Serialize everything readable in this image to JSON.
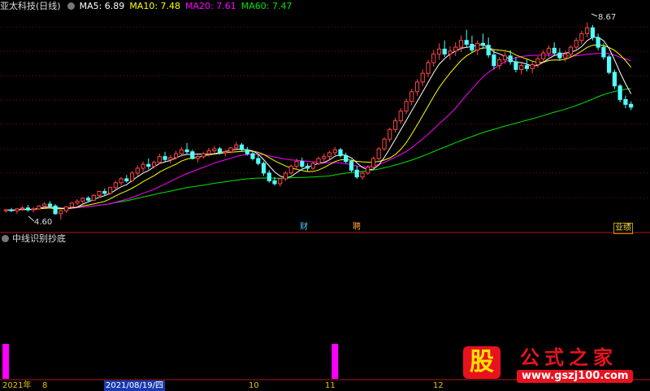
{
  "header": {
    "title": "亚太科技(日线)",
    "ma5": "MA5: 6.89",
    "ma10": "MA10: 7.48",
    "ma20": "MA20: 7.61",
    "ma60": "MA60: 7.47"
  },
  "sub_panel": {
    "title": "中线识别抄底"
  },
  "price_labels": {
    "high": "8.67",
    "low": "4.60"
  },
  "events": {
    "e1": "财",
    "e2": "聘",
    "e3": "业绩"
  },
  "x_axis": {
    "year": "2021年",
    "m8": "8",
    "cursor_date": "2021/08/19/四",
    "m10": "10",
    "m11": "11",
    "m12": "12"
  },
  "watermark": {
    "badge": "股",
    "title": "公式之家",
    "url": "www.gszj100.com"
  },
  "colors": {
    "up": "#ff4545",
    "down": "#54ffff",
    "ma5": "#ffffff",
    "ma10": "#ffff00",
    "ma20": "#ff00ff",
    "ma60": "#00e400",
    "signal": "#ff00ff"
  },
  "chart_data": {
    "type": "candlestick",
    "title": "亚太科技(日线)",
    "x_range": [
      "2021-07",
      "2021-12"
    ],
    "y_range": [
      4.5,
      8.9
    ],
    "candles_ohlc": [
      [
        4.78,
        4.82,
        4.74,
        4.8
      ],
      [
        4.8,
        4.84,
        4.76,
        4.78
      ],
      [
        4.78,
        4.84,
        4.72,
        4.82
      ],
      [
        4.82,
        4.88,
        4.78,
        4.84
      ],
      [
        4.84,
        4.9,
        4.76,
        4.8
      ],
      [
        4.8,
        4.86,
        4.74,
        4.82
      ],
      [
        4.82,
        4.9,
        4.8,
        4.88
      ],
      [
        4.88,
        4.96,
        4.84,
        4.92
      ],
      [
        4.92,
        4.98,
        4.86,
        4.88
      ],
      [
        4.88,
        4.92,
        4.7,
        4.72
      ],
      [
        4.72,
        4.8,
        4.6,
        4.78
      ],
      [
        4.78,
        4.88,
        4.74,
        4.86
      ],
      [
        4.86,
        4.96,
        4.82,
        4.94
      ],
      [
        4.94,
        5.02,
        4.9,
        4.98
      ],
      [
        4.98,
        5.06,
        4.94,
        5.04
      ],
      [
        5.04,
        5.08,
        4.96,
        5.0
      ],
      [
        5.0,
        5.12,
        4.98,
        5.1
      ],
      [
        5.1,
        5.2,
        5.06,
        5.18
      ],
      [
        5.18,
        5.24,
        5.1,
        5.14
      ],
      [
        5.14,
        5.28,
        5.12,
        5.26
      ],
      [
        5.26,
        5.4,
        5.22,
        5.36
      ],
      [
        5.36,
        5.48,
        5.3,
        5.44
      ],
      [
        5.44,
        5.52,
        5.36,
        5.4
      ],
      [
        5.4,
        5.6,
        5.38,
        5.56
      ],
      [
        5.56,
        5.72,
        5.5,
        5.66
      ],
      [
        5.66,
        5.8,
        5.58,
        5.74
      ],
      [
        5.74,
        5.86,
        5.64,
        5.7
      ],
      [
        5.7,
        5.82,
        5.66,
        5.78
      ],
      [
        5.78,
        5.96,
        5.74,
        5.9
      ],
      [
        5.9,
        6.0,
        5.78,
        5.84
      ],
      [
        5.84,
        5.94,
        5.76,
        5.88
      ],
      [
        5.88,
        6.02,
        5.84,
        5.96
      ],
      [
        5.96,
        6.1,
        5.9,
        6.04
      ],
      [
        6.04,
        6.18,
        5.94,
        6.0
      ],
      [
        6.0,
        6.04,
        5.84,
        5.86
      ],
      [
        5.86,
        5.94,
        5.78,
        5.9
      ],
      [
        5.9,
        6.0,
        5.86,
        5.96
      ],
      [
        5.96,
        6.08,
        5.9,
        6.02
      ],
      [
        6.02,
        6.12,
        5.96,
        6.06
      ],
      [
        6.06,
        6.1,
        5.94,
        5.98
      ],
      [
        5.98,
        6.04,
        5.9,
        6.0
      ],
      [
        6.0,
        6.1,
        5.96,
        6.08
      ],
      [
        6.08,
        6.2,
        6.02,
        6.14
      ],
      [
        6.14,
        6.18,
        6.0,
        6.04
      ],
      [
        6.04,
        6.1,
        5.92,
        5.96
      ],
      [
        5.96,
        6.0,
        5.82,
        5.86
      ],
      [
        5.86,
        5.94,
        5.72,
        5.76
      ],
      [
        5.76,
        5.8,
        5.5,
        5.56
      ],
      [
        5.56,
        5.62,
        5.36,
        5.4
      ],
      [
        5.4,
        5.48,
        5.3,
        5.34
      ],
      [
        5.34,
        5.46,
        5.28,
        5.44
      ],
      [
        5.44,
        5.6,
        5.4,
        5.56
      ],
      [
        5.56,
        5.74,
        5.52,
        5.7
      ],
      [
        5.7,
        5.86,
        5.64,
        5.8
      ],
      [
        5.8,
        5.88,
        5.66,
        5.7
      ],
      [
        5.7,
        5.76,
        5.6,
        5.66
      ],
      [
        5.66,
        5.8,
        5.62,
        5.76
      ],
      [
        5.76,
        5.9,
        5.72,
        5.86
      ],
      [
        5.86,
        5.96,
        5.8,
        5.9
      ],
      [
        5.9,
        6.02,
        5.84,
        5.98
      ],
      [
        5.98,
        6.1,
        5.92,
        6.04
      ],
      [
        6.04,
        6.08,
        5.88,
        5.92
      ],
      [
        5.92,
        5.98,
        5.76,
        5.8
      ],
      [
        5.8,
        5.84,
        5.58,
        5.62
      ],
      [
        5.62,
        5.7,
        5.44,
        5.48
      ],
      [
        5.48,
        5.6,
        5.42,
        5.56
      ],
      [
        5.56,
        5.72,
        5.52,
        5.68
      ],
      [
        5.68,
        5.9,
        5.64,
        5.86
      ],
      [
        5.86,
        6.1,
        5.82,
        6.06
      ],
      [
        6.06,
        6.3,
        6.02,
        6.26
      ],
      [
        6.26,
        6.5,
        6.2,
        6.46
      ],
      [
        6.46,
        6.7,
        6.4,
        6.64
      ],
      [
        6.64,
        6.9,
        6.58,
        6.84
      ],
      [
        6.84,
        7.1,
        6.78,
        7.04
      ],
      [
        7.04,
        7.3,
        6.96,
        7.24
      ],
      [
        7.24,
        7.5,
        7.16,
        7.44
      ],
      [
        7.44,
        7.7,
        7.36,
        7.62
      ],
      [
        7.62,
        7.9,
        7.54,
        7.84
      ],
      [
        7.84,
        8.1,
        7.76,
        8.02
      ],
      [
        8.02,
        8.24,
        7.9,
        8.12
      ],
      [
        8.12,
        8.3,
        7.96,
        8.02
      ],
      [
        8.02,
        8.18,
        7.9,
        8.08
      ],
      [
        8.08,
        8.26,
        7.98,
        8.16
      ],
      [
        8.16,
        8.4,
        8.06,
        8.3
      ],
      [
        8.3,
        8.52,
        8.16,
        8.22
      ],
      [
        8.22,
        8.4,
        8.04,
        8.1
      ],
      [
        8.1,
        8.3,
        8.0,
        8.24
      ],
      [
        8.24,
        8.44,
        8.12,
        8.2
      ],
      [
        8.2,
        8.36,
        7.94,
        8.0
      ],
      [
        8.0,
        8.1,
        7.7,
        7.78
      ],
      [
        7.78,
        7.96,
        7.7,
        7.9
      ],
      [
        7.9,
        8.06,
        7.82,
        7.98
      ],
      [
        7.98,
        8.1,
        7.8,
        7.86
      ],
      [
        7.86,
        7.96,
        7.64,
        7.7
      ],
      [
        7.7,
        7.84,
        7.6,
        7.78
      ],
      [
        7.78,
        7.9,
        7.66,
        7.72
      ],
      [
        7.72,
        7.86,
        7.62,
        7.8
      ],
      [
        7.8,
        7.98,
        7.74,
        7.92
      ],
      [
        7.92,
        8.1,
        7.86,
        8.04
      ],
      [
        8.04,
        8.2,
        7.96,
        8.14
      ],
      [
        8.14,
        8.26,
        7.98,
        8.04
      ],
      [
        8.04,
        8.14,
        7.88,
        7.94
      ],
      [
        7.94,
        8.08,
        7.86,
        8.02
      ],
      [
        8.02,
        8.2,
        7.96,
        8.16
      ],
      [
        8.16,
        8.36,
        8.1,
        8.3
      ],
      [
        8.3,
        8.5,
        8.22,
        8.44
      ],
      [
        8.44,
        8.67,
        8.36,
        8.56
      ],
      [
        8.56,
        8.62,
        8.3,
        8.36
      ],
      [
        8.36,
        8.44,
        8.1,
        8.16
      ],
      [
        8.16,
        8.24,
        7.9,
        7.96
      ],
      [
        7.96,
        8.0,
        7.6,
        7.64
      ],
      [
        7.64,
        7.7,
        7.3,
        7.36
      ],
      [
        7.36,
        7.4,
        7.02,
        7.08
      ],
      [
        7.08,
        7.16,
        6.9,
        6.98
      ],
      [
        6.98,
        7.04,
        6.86,
        6.92
      ]
    ],
    "signal_bars_index": [
      0,
      60
    ]
  }
}
